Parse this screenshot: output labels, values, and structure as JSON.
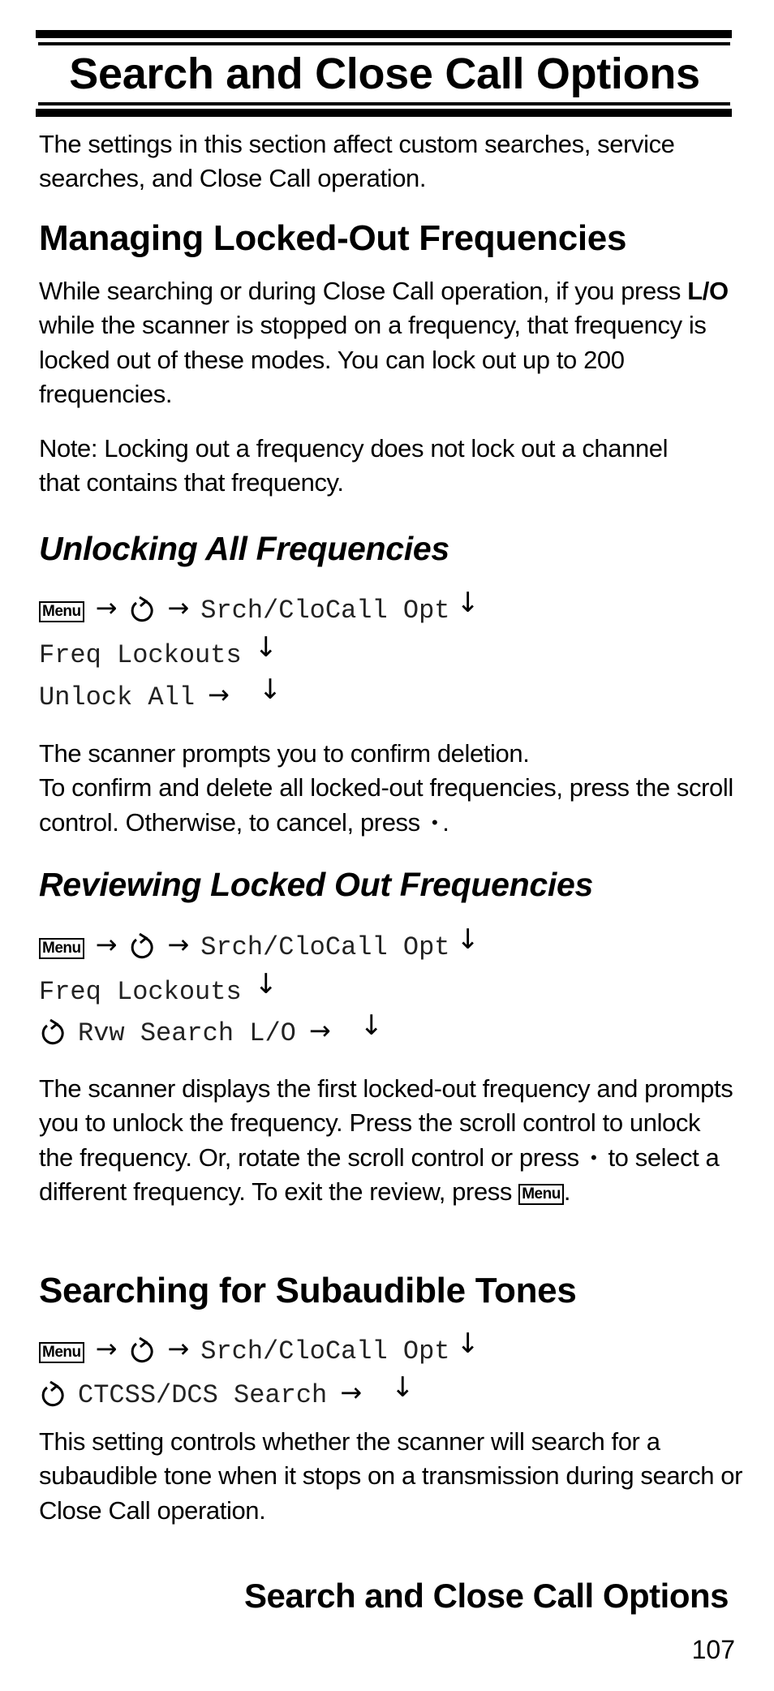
{
  "header": {
    "title": "Search and Close Call Options"
  },
  "intro": "The settings in this section affect custom searches, service searches, and Close Call operation.",
  "managing": {
    "heading": "Managing Locked-Out Frequencies",
    "para1_pre": "While searching or during Close Call operation, if you press ",
    "para1_bold": "L/O",
    "para1_post": " while the scanner is stopped on a frequency, that frequency is locked out of these modes. You can lock out up to 200 frequencies.",
    "note": "Note: Locking out a frequency does not lock out a channel that contains that frequency."
  },
  "icons": {
    "menu_key": "Menu",
    "right_arrow": "→",
    "down_arrow": "↓",
    "bullet": "•"
  },
  "unlocking": {
    "heading": "Unlocking All Frequencies",
    "path": {
      "line1_text": "Srch/CloCall Opt",
      "line2_text": "Freq Lockouts",
      "line3_text": "Unlock All"
    },
    "para_line1": "The scanner prompts you to confirm deletion.",
    "para_rest": "To confirm and delete all locked-out frequencies, press the scroll control. Otherwise, to cancel, press",
    "para_end": "."
  },
  "reviewing": {
    "heading": "Reviewing Locked Out Frequencies",
    "path": {
      "line1_text": "Srch/CloCall Opt",
      "line2_text": "Freq Lockouts",
      "line3_text": "Rvw Search L/O"
    },
    "para_a": "The scanner displays the first locked-out frequency and prompts you to unlock the frequency. Press the scroll control to unlock the frequency. Or, rotate the scroll control or press",
    "para_b": "to select a different frequency. To exit the review, press",
    "para_c": "."
  },
  "subaudible": {
    "heading": "Searching for Subaudible Tones",
    "path": {
      "line1_text": "Srch/CloCall Opt",
      "line2_text": "CTCSS/DCS Search"
    },
    "para": "This setting controls whether the scanner will search for a subaudible tone when it stops on a transmission during search or Close Call operation."
  },
  "footer": {
    "section_title": "Search and Close Call Options",
    "page_number": "107"
  }
}
